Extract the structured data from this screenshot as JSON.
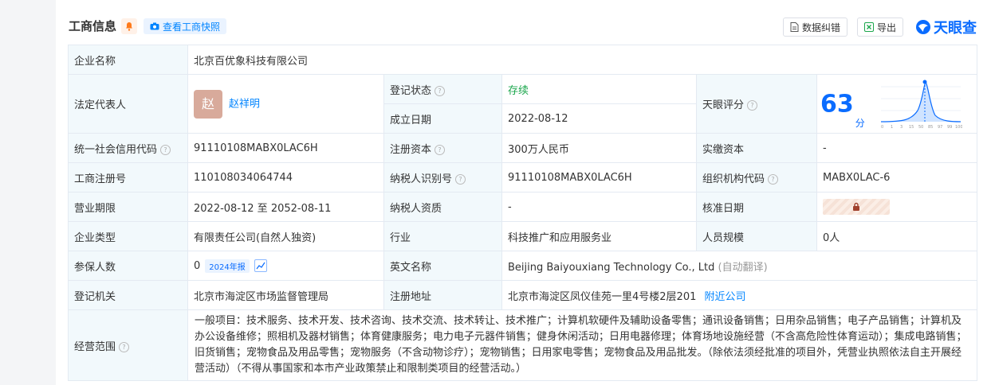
{
  "header": {
    "title": "工商信息",
    "snapshot_label": "查看工商快照",
    "correct_label": "数据纠错",
    "export_label": "导出",
    "logo_text": "天眼查"
  },
  "rows": {
    "company_name_label": "企业名称",
    "company_name": "北京百优象科技有限公司",
    "legal_rep_label": "法定代表人",
    "legal_rep_avatar": "赵",
    "legal_rep_name": "赵祥明",
    "status_label": "登记状态",
    "status_value": "存续",
    "found_date_label": "成立日期",
    "found_date_value": "2022-08-12",
    "rating_label": "天眼评分",
    "rating_score": "63",
    "rating_unit": "分",
    "rating_ticks": [
      "0",
      "1",
      "3",
      "15",
      "50",
      "85",
      "97",
      "99",
      "100"
    ],
    "credit_code_label": "统一社会信用代码",
    "credit_code_value": "91110108MABX0LAC6H",
    "reg_capital_label": "注册资本",
    "reg_capital_value": "300万人民币",
    "paid_capital_label": "实缴资本",
    "paid_capital_value": "-",
    "reg_no_label": "工商注册号",
    "reg_no_value": "110108034064744",
    "tax_id_label": "纳税人识别号",
    "tax_id_value": "91110108MABX0LAC6H",
    "org_code_label": "组织机构代码",
    "org_code_value": "MABX0LAC-6",
    "term_label": "营业期限",
    "term_value": "2022-08-12 至 2052-08-11",
    "tax_qual_label": "纳税人资质",
    "tax_qual_value": "-",
    "approve_date_label": "核准日期",
    "type_label": "企业类型",
    "type_value": "有限责任公司(自然人独资)",
    "industry_label": "行业",
    "industry_value": "科技推广和应用服务业",
    "staff_label": "人员规模",
    "staff_value": "0人",
    "insured_label": "参保人数",
    "insured_value": "0",
    "insured_badge": "2024年报",
    "en_name_label": "英文名称",
    "en_name_value": "Beijing Baiyouxiang Technology Co., Ltd",
    "en_name_note": "(自动翻译)",
    "authority_label": "登记机关",
    "authority_value": "北京市海淀区市场监督管理局",
    "address_label": "注册地址",
    "address_value": "北京市海淀区凤仪佳苑一里4号楼2层201",
    "nearby_label": "附近公司",
    "scope_label": "经营范围",
    "scope_value": "一般项目：技术服务、技术开发、技术咨询、技术交流、技术转让、技术推广；计算机软硬件及辅助设备零售；通讯设备销售；日用杂品销售；电子产品销售；计算机及办公设备维修；照相机及器材销售；体育健康服务；电力电子元器件销售；健身休闲活动；日用电器修理；体育场地设施经营（不含高危险性体育运动）；集成电路销售；旧货销售；宠物食品及用品零售；宠物服务（不含动物诊疗）；宠物销售；日用家电零售；宠物食品及用品批发。（除依法须经批准的项目外，凭营业执照依法自主开展经营活动）（不得从事国家和本市产业政策禁止和限制类项目的经营活动。）"
  },
  "colors": {
    "accent": "#0a6cff",
    "label_bg": "#f2f9fc",
    "status_green": "#1aa64b"
  }
}
